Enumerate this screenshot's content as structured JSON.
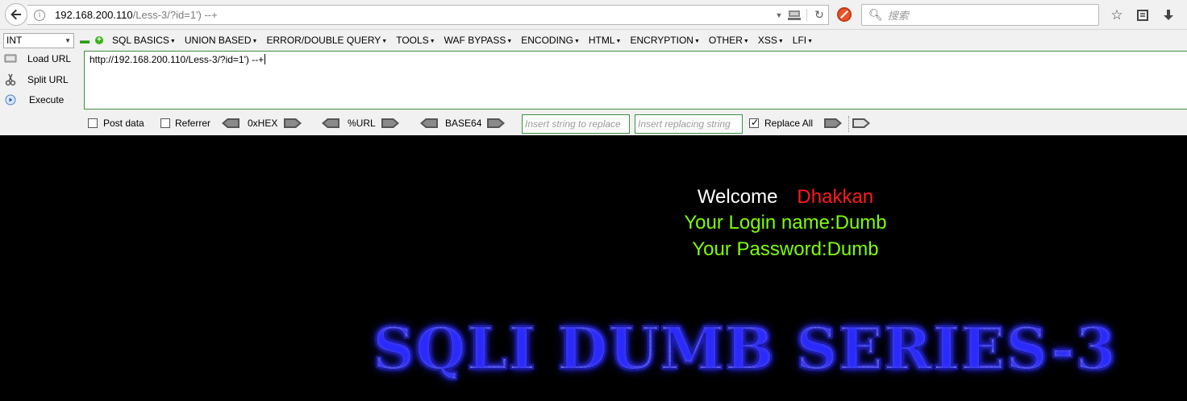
{
  "browser": {
    "url_host": "192.168.200.110",
    "url_path": "/Less-3/?id=1') --+",
    "search_placeholder": "搜索",
    "icons": [
      "back-arrow-icon",
      "info-icon",
      "dropdown-icon",
      "network-icon",
      "reload-icon",
      "block-icon",
      "search-icon",
      "bookmark-star-icon",
      "reading-list-icon",
      "download-icon"
    ]
  },
  "hackbar": {
    "type_select": "INT",
    "menu": [
      "SQL BASICS",
      "UNION BASED",
      "ERROR/DOUBLE QUERY",
      "TOOLS",
      "WAF BYPASS",
      "ENCODING",
      "HTML",
      "ENCRYPTION",
      "OTHER",
      "XSS",
      "LFI"
    ],
    "side": {
      "load": "Load URL",
      "split": "Split URL",
      "execute": "Execute"
    },
    "textarea_value": "http://192.168.200.110/Less-3/?id=1') --+",
    "post_data": "Post data",
    "referrer": "Referrer",
    "hex": "0xHEX",
    "url_enc": "%URL",
    "base64": "BASE64",
    "replace_find_placeholder": "Insert string to replace",
    "replace_with_placeholder": "Insert replacing string",
    "replace_all": "Replace All",
    "post_data_checked": false,
    "referrer_checked": false,
    "replace_all_checked": true
  },
  "page": {
    "welcome": "Welcome",
    "username": "Dhakkan",
    "login_name": "Your Login name:Dumb",
    "password": "Your Password:Dumb",
    "banner": "SQLI DUMB SERIES-3"
  },
  "colors": {
    "welcome": "#ffffff",
    "username": "#ff1a1a",
    "credentials": "#7fff00",
    "background": "#000000",
    "banner_glow": "#2a2aff"
  }
}
